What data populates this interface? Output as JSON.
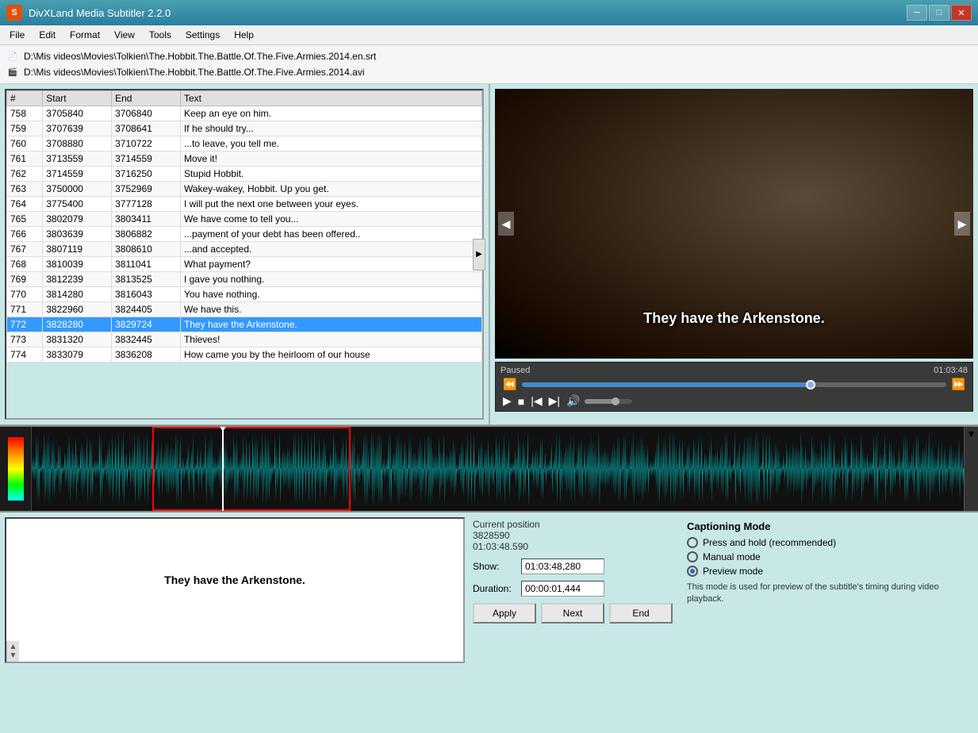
{
  "titlebar": {
    "icon": "S",
    "title": "DivXLand Media Subtitler 2.2.0",
    "minimize": "─",
    "maximize": "□",
    "close": "✕"
  },
  "menu": {
    "items": [
      "File",
      "Edit",
      "Format",
      "View",
      "Tools",
      "Settings",
      "Help"
    ]
  },
  "filepaths": {
    "srt": "D:\\Mis videos\\Movies\\Tolkien\\The.Hobbit.The.Battle.Of.The.Five.Armies.2014.en.srt",
    "avi": "D:\\Mis videos\\Movies\\Tolkien\\The.Hobbit.The.Battle.Of.The.Five.Armies.2014.avi"
  },
  "table": {
    "headers": [
      "#",
      "Start",
      "End",
      "Text"
    ],
    "rows": [
      {
        "num": "758",
        "start": "3705840",
        "end": "3706840",
        "text": "Keep an eye on him."
      },
      {
        "num": "759",
        "start": "3707639",
        "end": "3708641",
        "text": "If he should try..."
      },
      {
        "num": "760",
        "start": "3708880",
        "end": "3710722",
        "text": "...to leave, you tell me."
      },
      {
        "num": "761",
        "start": "3713559",
        "end": "3714559",
        "text": "Move it!"
      },
      {
        "num": "762",
        "start": "3714559",
        "end": "3716250",
        "text": "Stupid Hobbit."
      },
      {
        "num": "763",
        "start": "3750000",
        "end": "3752969",
        "text": "Wakey-wakey, Hobbit. Up you get."
      },
      {
        "num": "764",
        "start": "3775400",
        "end": "3777128",
        "text": "I will put the next one between your eyes."
      },
      {
        "num": "765",
        "start": "3802079",
        "end": "3803411",
        "text": "We have come to tell you..."
      },
      {
        "num": "766",
        "start": "3803639",
        "end": "3806882",
        "text": "...payment of your debt has been offered.."
      },
      {
        "num": "767",
        "start": "3807119",
        "end": "3808610",
        "text": "...and accepted."
      },
      {
        "num": "768",
        "start": "3810039",
        "end": "3811041",
        "text": "What payment?"
      },
      {
        "num": "769",
        "start": "3812239",
        "end": "3813525",
        "text": "I gave you nothing."
      },
      {
        "num": "770",
        "start": "3814280",
        "end": "3816043",
        "text": "You have nothing."
      },
      {
        "num": "771",
        "start": "3822960",
        "end": "3824405",
        "text": "We have this."
      },
      {
        "num": "772",
        "start": "3828280",
        "end": "3829724",
        "text": "They have the Arkenstone.",
        "selected": true
      },
      {
        "num": "773",
        "start": "3831320",
        "end": "3832445",
        "text": "Thieves!"
      },
      {
        "num": "774",
        "start": "3833079",
        "end": "3836208",
        "text": "How came you by the heirloom of our house"
      }
    ]
  },
  "video": {
    "subtitle_text": "They have the Arkenstone.",
    "status": "Paused",
    "timestamp": "01:03:48"
  },
  "caption_text": "They have the Arkenstone.",
  "position": {
    "label": "Current position",
    "frames": "3828590",
    "time": "01:03:48.590"
  },
  "show_field": {
    "label": "Show:",
    "value": "01:03:48,280"
  },
  "duration_field": {
    "label": "Duration:",
    "value": "00:00:01,444"
  },
  "buttons": {
    "apply": "Apply",
    "next": "Next",
    "end": "End"
  },
  "captioning_mode": {
    "title": "Captioning Mode",
    "options": [
      {
        "label": "Press and hold (recommended)",
        "selected": false
      },
      {
        "label": "Manual mode",
        "selected": false
      },
      {
        "label": "Preview mode",
        "selected": true
      }
    ],
    "description": "This mode is used for preview of the subtitle's timing during video playback."
  },
  "player": {
    "seek_pct": 68,
    "vol_pct": 65
  },
  "icons": {
    "rewind": "⏮",
    "prev": "⏭",
    "play": "▶",
    "stop": "■",
    "skip_back": "|◀",
    "skip_fwd": "▶|",
    "volume": "🔊",
    "fast_fwd": "⏩",
    "fast_rev": "⏪",
    "nav_left": "◀",
    "nav_right": "▶"
  }
}
